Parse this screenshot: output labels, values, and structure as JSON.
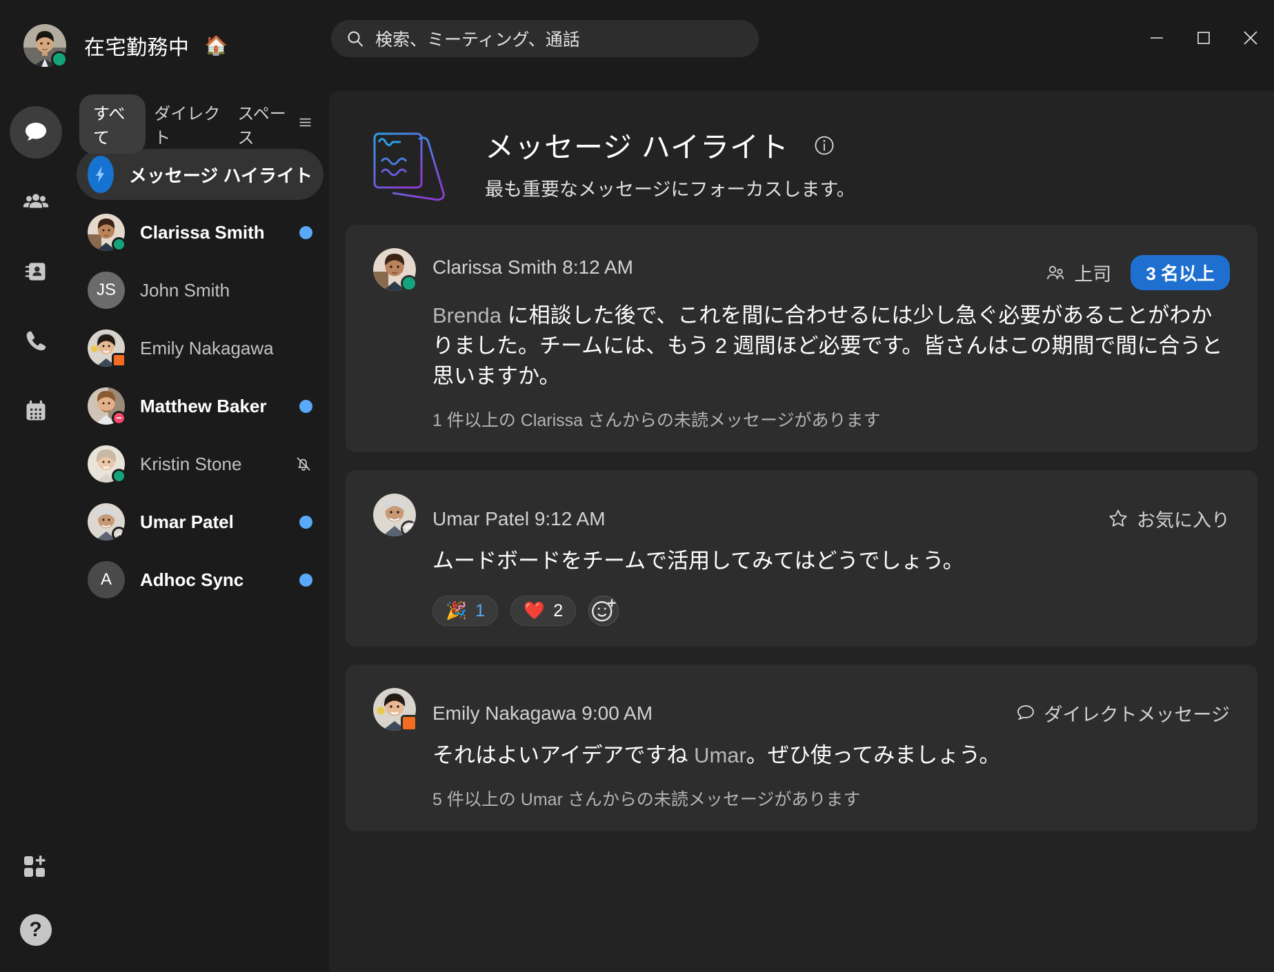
{
  "titlebar": {
    "status_text": "在宅勤務中",
    "status_emoji": "🏠",
    "avatar_name": "self-avatar"
  },
  "search": {
    "placeholder": "検索、ミーティング、通話",
    "icon": "search-icon"
  },
  "window_controls": {
    "minimize": "minimize-icon",
    "maximize": "maximize-icon",
    "close": "close-icon"
  },
  "rail": {
    "items": [
      {
        "name": "messaging",
        "icon": "chat-bubble-icon",
        "active": true
      },
      {
        "name": "teams",
        "icon": "people-icon",
        "active": false
      },
      {
        "name": "contacts",
        "icon": "contact-card-icon",
        "active": false
      },
      {
        "name": "calling",
        "icon": "phone-icon",
        "active": false
      },
      {
        "name": "meetings",
        "icon": "calendar-icon",
        "active": false
      }
    ],
    "bottom": [
      {
        "name": "apps",
        "icon": "add-apps-icon"
      },
      {
        "name": "help",
        "icon": "help-icon",
        "label": "?"
      }
    ]
  },
  "list": {
    "filters": [
      {
        "label": "すべて",
        "active": true
      },
      {
        "label": "ダイレクト",
        "active": false
      },
      {
        "label": "スペース",
        "active": false
      }
    ],
    "filter_icon": "filter-lines-icon",
    "items": [
      {
        "name": "メッセージ ハイライト",
        "type": "highlight",
        "icon": "bolt-icon",
        "selected": true,
        "unread": false,
        "muted": false,
        "presence": ""
      },
      {
        "name": "Clarissa Smith",
        "type": "person",
        "selected": false,
        "unread": true,
        "muted": false,
        "presence": "available"
      },
      {
        "name": "John Smith",
        "type": "initials",
        "initials": "JS",
        "selected": false,
        "unread": false,
        "muted": false,
        "presence": ""
      },
      {
        "name": "Emily Nakagawa",
        "type": "person",
        "selected": false,
        "unread": false,
        "muted": false,
        "presence": "video"
      },
      {
        "name": "Matthew Baker",
        "type": "person",
        "selected": false,
        "unread": true,
        "muted": false,
        "presence": "dnd"
      },
      {
        "name": "Kristin Stone",
        "type": "person",
        "selected": false,
        "unread": false,
        "muted": true,
        "presence": "available"
      },
      {
        "name": "Umar Patel",
        "type": "person",
        "selected": false,
        "unread": true,
        "muted": false,
        "presence": "ooo"
      },
      {
        "name": "Adhoc Sync",
        "type": "initials",
        "initials": "A",
        "selected": false,
        "unread": true,
        "muted": false,
        "presence": ""
      }
    ]
  },
  "panel": {
    "title": "メッセージ ハイライト",
    "subtitle": "最も重要なメッセージにフォーカスします。",
    "info_icon": "info-icon",
    "illustration": "message-highlights-illustration"
  },
  "messages": [
    {
      "author": "Clarissa Smith",
      "time": "8:12 AM",
      "meta": "Clarissa Smith 8:12 AM",
      "presence": "available",
      "badge_label": "上司",
      "badge_icon": "people-badge-icon",
      "pill": "3 名以上",
      "body_mention": "Brenda",
      "body_rest": " に相談した後で、これを間に合わせるには少し急ぐ必要があることがわかりました。チームには、もう 2 週間ほど必要です。皆さんはこの期間で間に合うと思いますか。",
      "footer": "1 件以上の Clarissa さんからの未読メッセージがあります",
      "reactions": []
    },
    {
      "author": "Umar Patel",
      "time": "9:12 AM",
      "meta": "Umar Patel  9:12 AM",
      "presence": "ooo",
      "badge_label": "お気に入り",
      "badge_icon": "star-icon",
      "pill": "",
      "body_mention": "",
      "body_rest": "ムードボードをチームで活用してみてはどうでしょう。",
      "footer": "",
      "reactions": [
        {
          "emoji": "🎉",
          "count": "1",
          "mine": true
        },
        {
          "emoji": "❤️",
          "count": "2",
          "mine": false
        }
      ],
      "add_reaction_icon": "add-reaction-icon"
    },
    {
      "author": "Emily Nakagawa",
      "time": "9:00 AM",
      "meta": "Emily Nakagawa  9:00 AM",
      "presence": "video",
      "badge_label": "ダイレクトメッセージ",
      "badge_icon": "chat-bubble-badge-icon",
      "pill": "",
      "body_mention_tail": "Umar",
      "body_rest": "それはよいアイデアですね ",
      "body_tail": "。ぜひ使ってみましょう。",
      "footer": "5 件以上の Umar さんからの未読メッセージがあります",
      "reactions": []
    }
  ],
  "colors": {
    "accent_blue": "#1f6fd0",
    "unread_dot": "#5aa9f8",
    "available": "#14a47c",
    "dnd": "#f1486b",
    "video": "#f26d21",
    "panel_bg": "#232323",
    "card_bg": "#2d2d2d"
  }
}
